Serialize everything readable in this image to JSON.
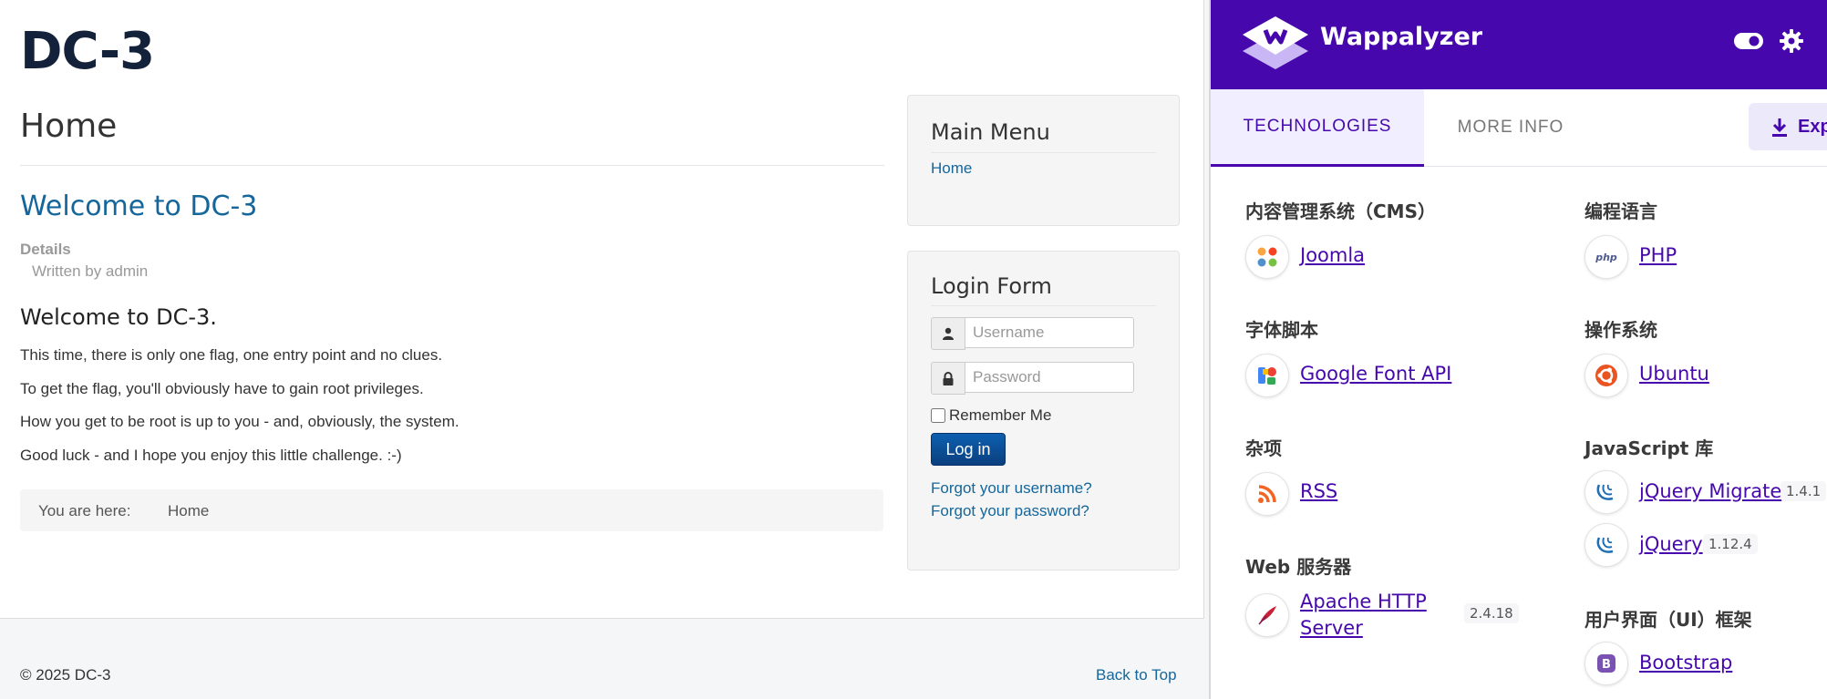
{
  "site": {
    "title": "DC-3",
    "page_heading": "Home",
    "article_title": "Welcome to DC-3",
    "details_label": "Details",
    "written_by": "Written by admin",
    "intro_heading": "Welcome to DC-3.",
    "paragraphs": [
      "This time, there is only one flag, one entry point and no clues.",
      "To get the flag, you'll obviously have to gain root privileges.",
      "How you get to be root is up to you - and, obviously, the system.",
      "Good luck - and I hope you enjoy this little challenge.  :-)"
    ],
    "breadcrumb": {
      "label": "You are here:",
      "current": "Home"
    },
    "main_menu": {
      "title": "Main Menu",
      "items": [
        "Home"
      ]
    },
    "login_form": {
      "title": "Login Form",
      "username_placeholder": "Username",
      "password_placeholder": "Password",
      "remember_label": "Remember Me",
      "login_button": "Log in",
      "forgot_username": "Forgot your username?",
      "forgot_password": "Forgot your password?"
    },
    "footer": {
      "copyright": "© 2025 DC-3",
      "back_to_top": "Back to Top"
    },
    "colors": {
      "link": "#15669a",
      "button": "#0a4a94"
    }
  },
  "wappalyzer": {
    "brand": "Wappalyzer",
    "header_icons": [
      "toggle-icon",
      "gear-icon"
    ],
    "tabs": [
      {
        "label": "TECHNOLOGIES",
        "active": true
      },
      {
        "label": "MORE INFO",
        "active": false
      }
    ],
    "export_label": "Exp",
    "colors": {
      "brand": "#4608ad",
      "active_tab_bg": "#f1efff"
    },
    "categories": [
      {
        "name": "内容管理系统（CMS）",
        "items": [
          {
            "name": "Joomla",
            "icon": "joomla-icon",
            "version": ""
          }
        ]
      },
      {
        "name": "字体脚本",
        "items": [
          {
            "name": "Google Font API",
            "icon": "google-font-icon",
            "version": ""
          }
        ]
      },
      {
        "name": "杂项",
        "items": [
          {
            "name": "RSS",
            "icon": "rss-icon",
            "version": ""
          }
        ]
      },
      {
        "name": "Web 服务器",
        "items": [
          {
            "name_line1": "Apache HTTP",
            "name_line2": "Server",
            "icon": "apache-feather-icon",
            "version": "2.4.18"
          }
        ]
      },
      {
        "name": "编程语言",
        "items": [
          {
            "name": "PHP",
            "icon": "php-icon",
            "version": ""
          }
        ]
      },
      {
        "name": "操作系统",
        "items": [
          {
            "name": "Ubuntu",
            "icon": "ubuntu-icon",
            "version": ""
          }
        ]
      },
      {
        "name": "JavaScript 库",
        "items": [
          {
            "name": "jQuery Migrate",
            "icon": "jquery-icon",
            "version": "1.4.1"
          },
          {
            "name": "jQuery",
            "icon": "jquery-icon",
            "version": "1.12.4"
          }
        ]
      },
      {
        "name": "用户界面（UI）框架",
        "items": [
          {
            "name": "Bootstrap",
            "icon": "bootstrap-icon",
            "version": ""
          }
        ]
      }
    ]
  }
}
